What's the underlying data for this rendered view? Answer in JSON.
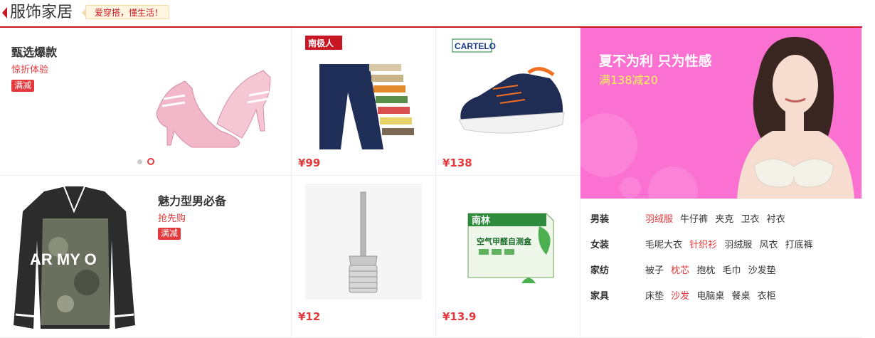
{
  "header": {
    "title": "服饰家居",
    "tag": "爱穿搭，懂生活！"
  },
  "featured": [
    {
      "title": "甄选爆款",
      "subtitle": "惊折体验",
      "badge": "满减"
    },
    {
      "title": "魅力型男必备",
      "subtitle": "抢先购",
      "badge": "满减"
    }
  ],
  "products": [
    {
      "brand": "南极人",
      "price": "¥99"
    },
    {
      "brand": "CARTELO",
      "price": "¥138"
    },
    {
      "brand": "",
      "price": "¥12"
    },
    {
      "brand": "南林",
      "product_text": "空气甲醛自测盒",
      "price": "¥13.9"
    }
  ],
  "banner": {
    "title": "夏不为利 只为性感",
    "subtitle": "满138减20"
  },
  "categories": [
    {
      "label": "男装",
      "items": [
        {
          "text": "羽绒服",
          "highlight": true
        },
        {
          "text": "牛仔裤",
          "highlight": false
        },
        {
          "text": "夹克",
          "highlight": false
        },
        {
          "text": "卫衣",
          "highlight": false
        },
        {
          "text": "衬衣",
          "highlight": false
        }
      ]
    },
    {
      "label": "女装",
      "items": [
        {
          "text": "毛呢大衣",
          "highlight": false
        },
        {
          "text": "针织衫",
          "highlight": true
        },
        {
          "text": "羽绒服",
          "highlight": false
        },
        {
          "text": "风衣",
          "highlight": false
        },
        {
          "text": "打底裤",
          "highlight": false
        }
      ]
    },
    {
      "label": "家纺",
      "items": [
        {
          "text": "被子",
          "highlight": false
        },
        {
          "text": "枕芯",
          "highlight": true
        },
        {
          "text": "抱枕",
          "highlight": false
        },
        {
          "text": "毛巾",
          "highlight": false
        },
        {
          "text": "沙发垫",
          "highlight": false
        }
      ]
    },
    {
      "label": "家具",
      "items": [
        {
          "text": "床垫",
          "highlight": false
        },
        {
          "text": "沙发",
          "highlight": true
        },
        {
          "text": "电脑桌",
          "highlight": false
        },
        {
          "text": "餐桌",
          "highlight": false
        },
        {
          "text": "衣柜",
          "highlight": false
        }
      ]
    }
  ],
  "colors": {
    "accent": "#e4393c",
    "brand_red": "#c81623",
    "banner_bg": "#fa71d2",
    "banner_sub": "#fff35a"
  }
}
